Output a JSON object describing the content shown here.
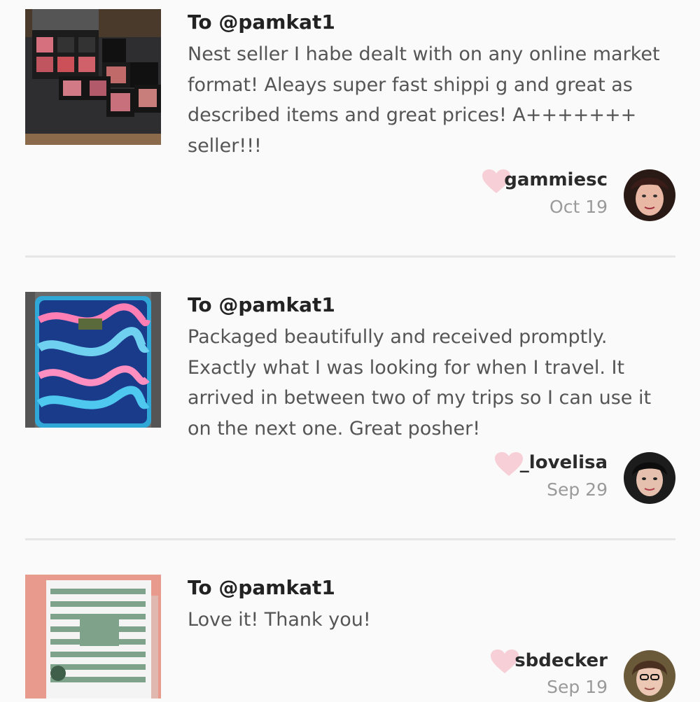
{
  "reviews": [
    {
      "to": "To @pamkat1",
      "text": "Nest seller I habe dealt with on any online market format! Aleays super fast shippi g and great as described items and great prices! A+++++++ seller!!!",
      "user": "gammiesc",
      "date": "Oct 19"
    },
    {
      "to": "To @pamkat1",
      "text": "Packaged beautifully and received promptly. Exactly what I was looking for when I travel. It arrived in between two of my trips so I can use it on the next one. Great posher!",
      "user": "_lovelisa",
      "date": "Sep 29"
    },
    {
      "to": "To @pamkat1",
      "text": "Love it! Thank you!",
      "user": "sbdecker",
      "date": "Sep 19"
    }
  ],
  "colors": {
    "heart": "#f7cfd6",
    "divider": "#e6e6e6"
  }
}
